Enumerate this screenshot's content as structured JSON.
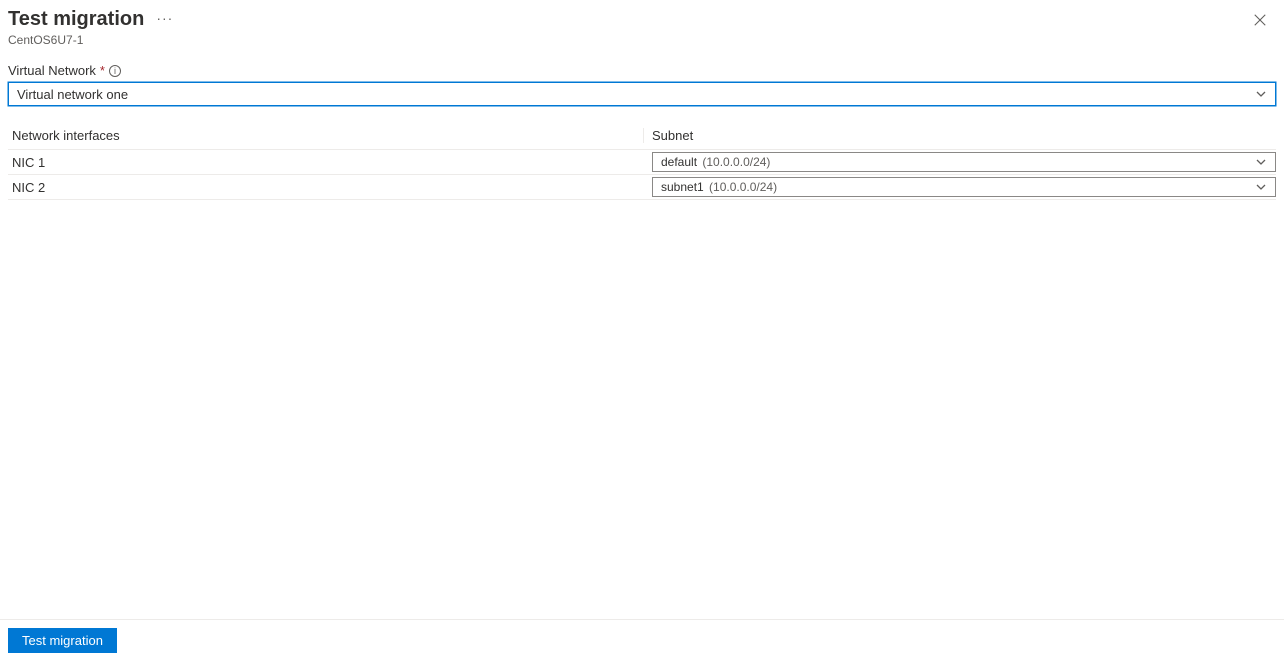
{
  "header": {
    "title": "Test migration",
    "subtitle": "CentOS6U7-1"
  },
  "form": {
    "vnet_label": "Virtual Network",
    "vnet_value": "Virtual network one"
  },
  "table": {
    "col_nic": "Network interfaces",
    "col_subnet": "Subnet",
    "rows": [
      {
        "nic": "NIC 1",
        "subnet_name": "default",
        "subnet_cidr": "(10.0.0.0/24)"
      },
      {
        "nic": "NIC 2",
        "subnet_name": "subnet1",
        "subnet_cidr": "(10.0.0.0/24)"
      }
    ]
  },
  "footer": {
    "primary_button": "Test migration"
  }
}
